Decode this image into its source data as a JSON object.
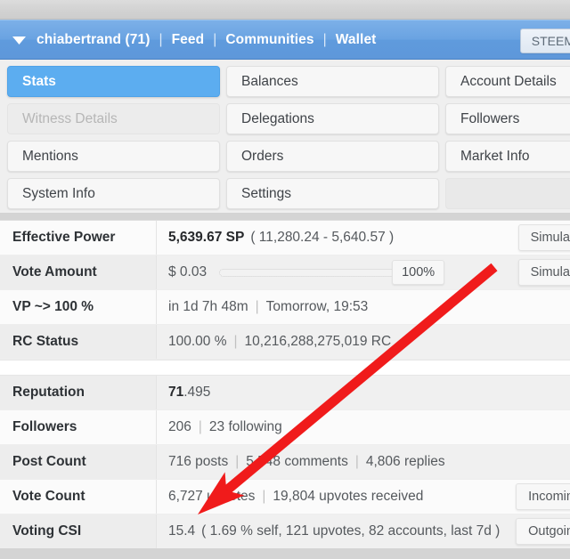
{
  "header": {
    "caret_icon": "chevron-down-icon",
    "username": "chiabertrand (71)",
    "separator": "|",
    "links": [
      "Feed",
      "Communities",
      "Wallet"
    ],
    "right_button": "STEEM",
    "background_color": "#6aa3e2"
  },
  "tabs": {
    "rows": [
      [
        {
          "label": "Stats",
          "state": "active"
        },
        {
          "label": "Balances",
          "state": "normal"
        },
        {
          "label": "Account Details",
          "state": "normal"
        }
      ],
      [
        {
          "label": "Witness Details",
          "state": "disabled"
        },
        {
          "label": "Delegations",
          "state": "normal"
        },
        {
          "label": "Followers",
          "state": "normal"
        }
      ],
      [
        {
          "label": "Mentions",
          "state": "normal"
        },
        {
          "label": "Orders",
          "state": "normal"
        },
        {
          "label": "Market Info",
          "state": "normal"
        }
      ],
      [
        {
          "label": "System Info",
          "state": "normal"
        },
        {
          "label": "Settings",
          "state": "normal"
        },
        {
          "label": "",
          "state": "empty"
        }
      ]
    ],
    "active_color": "#5cadf0"
  },
  "stats": {
    "group_one": [
      {
        "label": "Effective Power",
        "value_strong": "5,639.67 SP",
        "value_rest": "( 11,280.24 - 5,640.57 )",
        "action": "Simulate"
      },
      {
        "label": "Vote Amount",
        "value_strong": "$ 0.03",
        "slider_percent": "100%",
        "action": "Simulate"
      },
      {
        "label": "VP ~> 100 %",
        "parts": [
          "in 1d 7h 48m",
          "Tomorrow, 19:53"
        ]
      },
      {
        "label": "RC Status",
        "parts": [
          "100.00 %",
          "10,216,288,275,019 RC"
        ]
      }
    ],
    "group_two": [
      {
        "label": "Reputation",
        "value_strong": "71",
        "value_rest": ".495"
      },
      {
        "label": "Followers",
        "parts": [
          "206",
          "23 following"
        ]
      },
      {
        "label": "Post Count",
        "parts": [
          "716 posts",
          "5,548 comments",
          "4,806 replies"
        ]
      },
      {
        "label": "Vote Count",
        "parts": [
          "6,727 upvotes",
          "19,804 upvotes received"
        ],
        "action": "Incoming"
      },
      {
        "label": "Voting CSI",
        "value_strong": "15.4",
        "value_rest": "( 1.69 % self, 121 upvotes, 82 accounts, last 7d )",
        "action": "Outgoing"
      }
    ]
  },
  "annotation": {
    "arrow_color": "#f01b1b",
    "arrow_from": "555,300",
    "arrow_to": "222,578"
  }
}
